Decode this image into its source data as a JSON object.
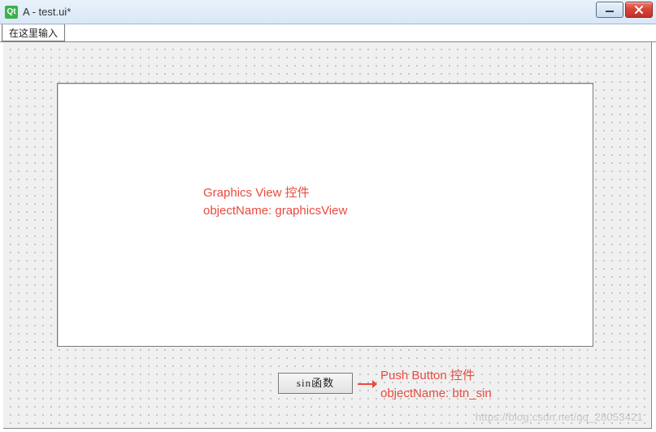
{
  "window": {
    "title": "A - test.ui*",
    "icon_label": "Qt"
  },
  "menubar": {
    "type_here": "在这里输入"
  },
  "widgets": {
    "button_label": "sin函数"
  },
  "annotations": {
    "graphics_view_line1": "Graphics View 控件",
    "graphics_view_line2": "objectName: graphicsView",
    "button_line1": "Push Button 控件",
    "button_line2": "objectName: btn_sin"
  },
  "watermark": "https://blog.csdn.net/qq_28053421"
}
